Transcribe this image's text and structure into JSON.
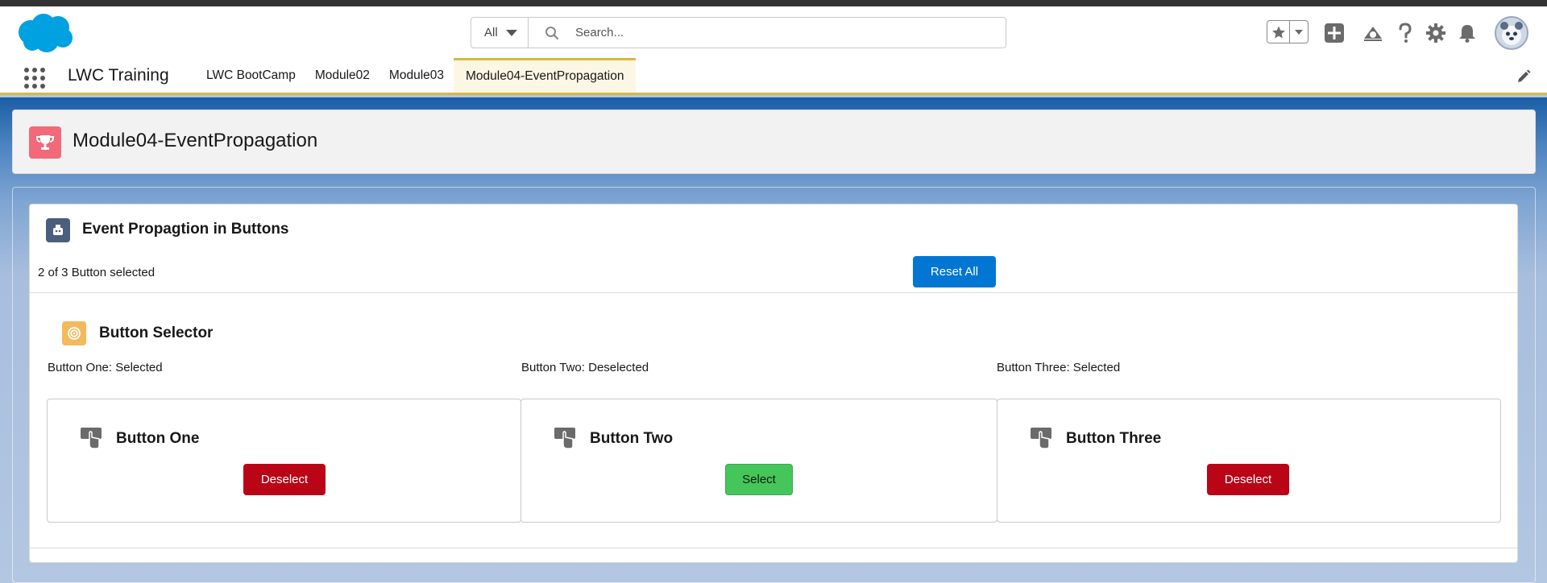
{
  "header": {
    "search": {
      "scope": "All",
      "placeholder": "Search..."
    },
    "icons": [
      "salesforce-logo",
      "star-icon",
      "chevron-down-icon",
      "add-icon",
      "trailhead-icon",
      "help-icon",
      "gear-icon",
      "bell-icon",
      "avatar"
    ]
  },
  "nav": {
    "app_name": "LWC Training",
    "tabs": [
      {
        "label": "LWC BootCamp",
        "active": false
      },
      {
        "label": "Module02",
        "active": false
      },
      {
        "label": "Module03",
        "active": false
      },
      {
        "label": "Module04-EventPropagation",
        "active": true
      }
    ]
  },
  "page": {
    "title": "Module04-EventPropagation"
  },
  "card": {
    "title": "Event Propagtion in Buttons",
    "count_text": "2 of 3 Button selected",
    "reset_label": "Reset All"
  },
  "selector": {
    "title": "Button Selector",
    "statuses": [
      "Button One: Selected",
      "Button Two: Deselected",
      "Button Three: Selected"
    ],
    "buttons": [
      {
        "title": "Button One",
        "action": "Deselect"
      },
      {
        "title": "Button Two",
        "action": "Select"
      },
      {
        "title": "Button Three",
        "action": "Deselect"
      }
    ]
  },
  "colors": {
    "brand": "#0176d3",
    "deselect": "#ba0517",
    "select": "#45c65a",
    "nav_accent": "#d7b93d",
    "page_icon": "#f26979"
  }
}
